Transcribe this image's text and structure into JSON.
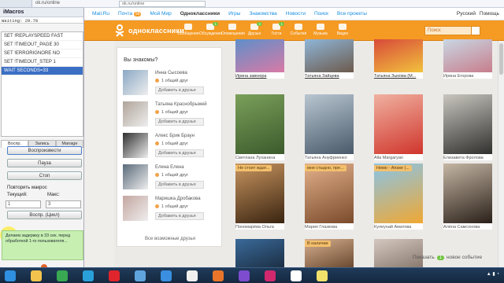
{
  "browser": {
    "tab_title": "ok.ru/online",
    "url": "ok.ru/online"
  },
  "imacros": {
    "title": "iMacros",
    "status": "Waiting: 29.70",
    "macros": [
      "SET !REPLAYSPEED FAST",
      "SET !TIMEOUT_PAGE 30",
      "SET !ERRORIGNORE NO",
      "SET !TIMEOUT_STEP 1",
      "WAIT SECONDS=33"
    ],
    "active_index": 4,
    "tabs": [
      "Воспр.",
      "Запись",
      "Manage"
    ],
    "play_btn": "Воспроизвести",
    "pause_btn": "Пауза",
    "stop_btn": "Стоп",
    "repeat_label": "Повторить макрос",
    "current_label": "Текущий:",
    "max_label": "Макс:",
    "current_value": "1",
    "max_value": "3",
    "loop_btn": "Воспр. (Цикл)",
    "note": "Делаем задержку в 33 сек. перед обработкой 1-го пользователя..."
  },
  "mailru_bar": {
    "items": [
      "Mail.Ru",
      "Почта",
      "Мой Мир",
      "Одноклассники",
      "Игры",
      "Знакомства",
      "Новости",
      "Поиск",
      "Все проекты"
    ],
    "mail_badge": "99",
    "lang": "Русский",
    "help": "Помощь"
  },
  "ok": {
    "logo_text": "одноклассники",
    "nav": [
      {
        "label": "Сообщения",
        "badge": ""
      },
      {
        "label": "Обсуждения",
        "badge": "1"
      },
      {
        "label": "Оповещения",
        "badge": ""
      },
      {
        "label": "Друзья",
        "badge": "2"
      },
      {
        "label": "Гости",
        "badge": "1"
      },
      {
        "label": "События",
        "badge": ""
      },
      {
        "label": "Музыка",
        "badge": ""
      },
      {
        "label": "Видео",
        "badge": ""
      }
    ],
    "search_placeholder": "Поиск"
  },
  "friends": {
    "title": "Вы знакомы?",
    "mutual": "1 общий друг",
    "add_label": "Добавить в друзья",
    "items": [
      {
        "name": "Инна Сысоева"
      },
      {
        "name": "Татьяна Краснобрыжей"
      },
      {
        "name": "Алекс Брик Браун"
      },
      {
        "name": "Елена Елена"
      },
      {
        "name": "Маришка Дробакова"
      }
    ],
    "all_link": "Все возможные друзья"
  },
  "photos": [
    {
      "name": "Ирина завоюра",
      "label": "",
      "colors": [
        "#5f8fc9",
        "#d97aa6"
      ]
    },
    {
      "name": "Татьяна Зайцева",
      "label": "",
      "colors": [
        "#8fb6d8",
        "#6c5a4c"
      ]
    },
    {
      "name": "Татьяна Зыкова (М...",
      "label": "",
      "colors": [
        "#d84a3a",
        "#f2c23c"
      ]
    },
    {
      "name": "Ирина Егорова",
      "label": "",
      "colors": [
        "#c9d7e3",
        "#c77d8c"
      ]
    },
    {
      "name": "Светлана Луханина",
      "label": "",
      "colors": [
        "#7aa05a",
        "#3c5a2c"
      ]
    },
    {
      "name": "Татьяна Ануфриенко",
      "label": "",
      "colors": [
        "#b8c6d1",
        "#4a5a6a"
      ]
    },
    {
      "name": "Alla Margaryan",
      "label": "",
      "colors": [
        "#f0b1a0",
        "#d0352c"
      ]
    },
    {
      "name": "Елизавета Фролова",
      "label": "",
      "colors": [
        "#c9c6bf",
        "#30302e"
      ]
    },
    {
      "name": "Пономарёва Ольга",
      "label": "Не стоит ждат...",
      "colors": [
        "#c89560",
        "#3a2410"
      ]
    },
    {
      "name": "Мария Глазкова",
      "label": "мне стыдно, пре...",
      "colors": [
        "#e3b08a",
        "#7a4b2c"
      ]
    },
    {
      "name": "Кулеунай Аматова",
      "label": "Немо - Апаке (...",
      "colors": [
        "#88c4e8",
        "#f0a833"
      ]
    },
    {
      "name": "Алёна Самсонова",
      "label": "",
      "colors": [
        "#c5b6a4",
        "#2a2019"
      ]
    },
    {
      "name": "",
      "label": "",
      "colors": [
        "#3a6a9a",
        "#1c2f44"
      ]
    },
    {
      "name": "",
      "label": "В наличии",
      "colors": [
        "#d8b090",
        "#6a4a30"
      ]
    },
    {
      "name": "",
      "label": "",
      "colors": [
        "#d4c8c0",
        "#8a7a70"
      ]
    }
  ],
  "show_new": {
    "prefix": "Показать",
    "count": "1",
    "suffix": "новое событие"
  },
  "taskbar": {
    "icon_names": [
      "start-icon",
      "explorer-icon",
      "chrome-icon",
      "telegram-icon",
      "opera-icon",
      "recycle-icon",
      "ie-icon",
      "yandex-icon",
      "firefox-icon",
      "viber-icon",
      "w-app-icon",
      "imacros-icon",
      "note-icon"
    ],
    "icon_colors": [
      "#2f8fe0",
      "#f3c44d",
      "#39a853",
      "#2aa0da",
      "#e0242c",
      "#60a4de",
      "#3a8fe0",
      "#f0f0f0",
      "#e8752a",
      "#7d4ccf",
      "#d1286e",
      "#ffffff",
      "#f2e06a"
    ]
  }
}
